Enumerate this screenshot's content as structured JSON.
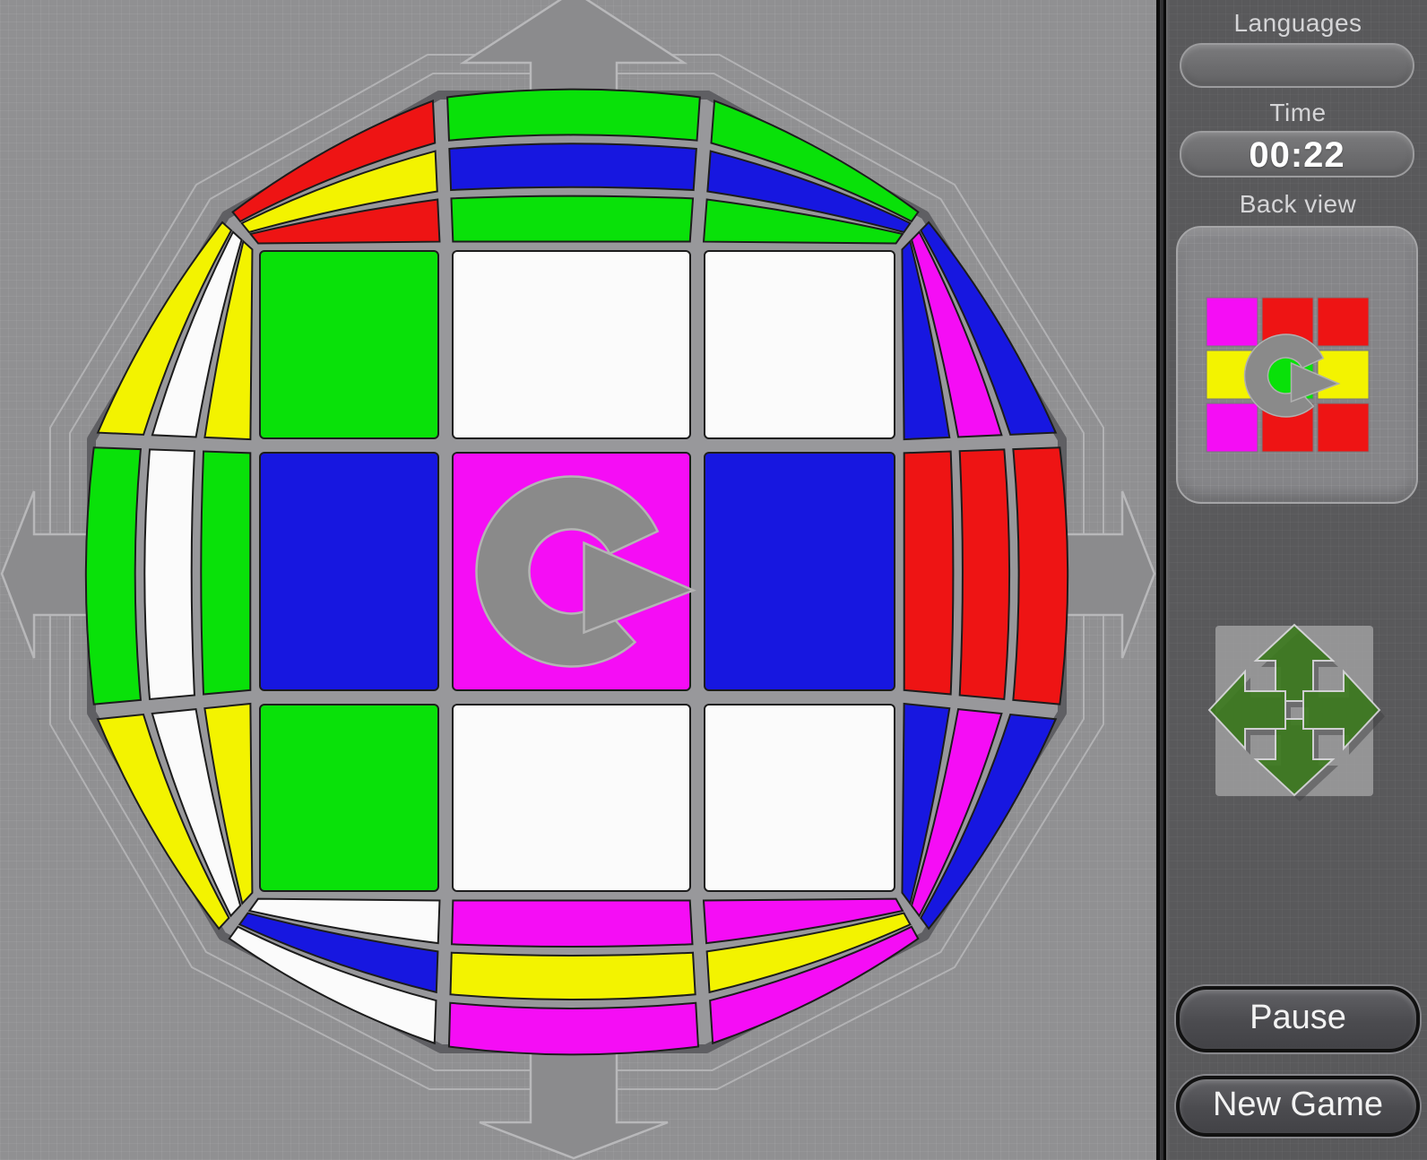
{
  "palette": {
    "green": "#09e109",
    "white": "#fbfbfb",
    "blue": "#1717e0",
    "magenta": "#f50df5",
    "red": "#ee1414",
    "yellow": "#f3f300",
    "icon_gray": "#8a8a8a",
    "move_green": "#3c7a1e"
  },
  "sidebar": {
    "languages_label": "Languages",
    "languages_value": "",
    "time_label": "Time",
    "time_value": "00:22",
    "back_view_label": "Back view",
    "pause_label": "Pause",
    "new_game_label": "New Game"
  },
  "cube": {
    "center_icon": "rotate-clockwise-icon",
    "front": [
      [
        "green",
        "white",
        "white"
      ],
      [
        "blue",
        "magenta",
        "blue"
      ],
      [
        "green",
        "white",
        "white"
      ]
    ],
    "ring": [
      {
        "side": "top-left",
        "stripes": [
          "red",
          "yellow",
          "red"
        ]
      },
      {
        "side": "top-middle",
        "stripes": [
          "green",
          "blue",
          "green"
        ]
      },
      {
        "side": "top-right",
        "stripes": [
          "green",
          "blue",
          "green"
        ]
      },
      {
        "side": "right-top",
        "stripes": [
          "blue",
          "magenta",
          "blue"
        ]
      },
      {
        "side": "right-middle",
        "stripes": [
          "red",
          "red",
          "red"
        ]
      },
      {
        "side": "right-bottom",
        "stripes": [
          "blue",
          "magenta",
          "blue"
        ]
      },
      {
        "side": "bottom-right",
        "stripes": [
          "magenta",
          "yellow",
          "magenta"
        ]
      },
      {
        "side": "bottom-middle",
        "stripes": [
          "magenta",
          "yellow",
          "magenta"
        ]
      },
      {
        "side": "bottom-left",
        "stripes": [
          "white",
          "blue",
          "white"
        ]
      },
      {
        "side": "left-bottom",
        "stripes": [
          "yellow",
          "white",
          "yellow"
        ]
      },
      {
        "side": "left-middle",
        "stripes": [
          "green",
          "white",
          "green"
        ]
      },
      {
        "side": "left-top",
        "stripes": [
          "yellow",
          "white",
          "yellow"
        ]
      }
    ]
  },
  "back_view": {
    "center_icon": "rotate-clockwise-icon",
    "rows": [
      [
        "magenta",
        "red",
        "red"
      ],
      [
        "yellow",
        "green",
        "yellow"
      ],
      [
        "magenta",
        "red",
        "red"
      ]
    ]
  }
}
